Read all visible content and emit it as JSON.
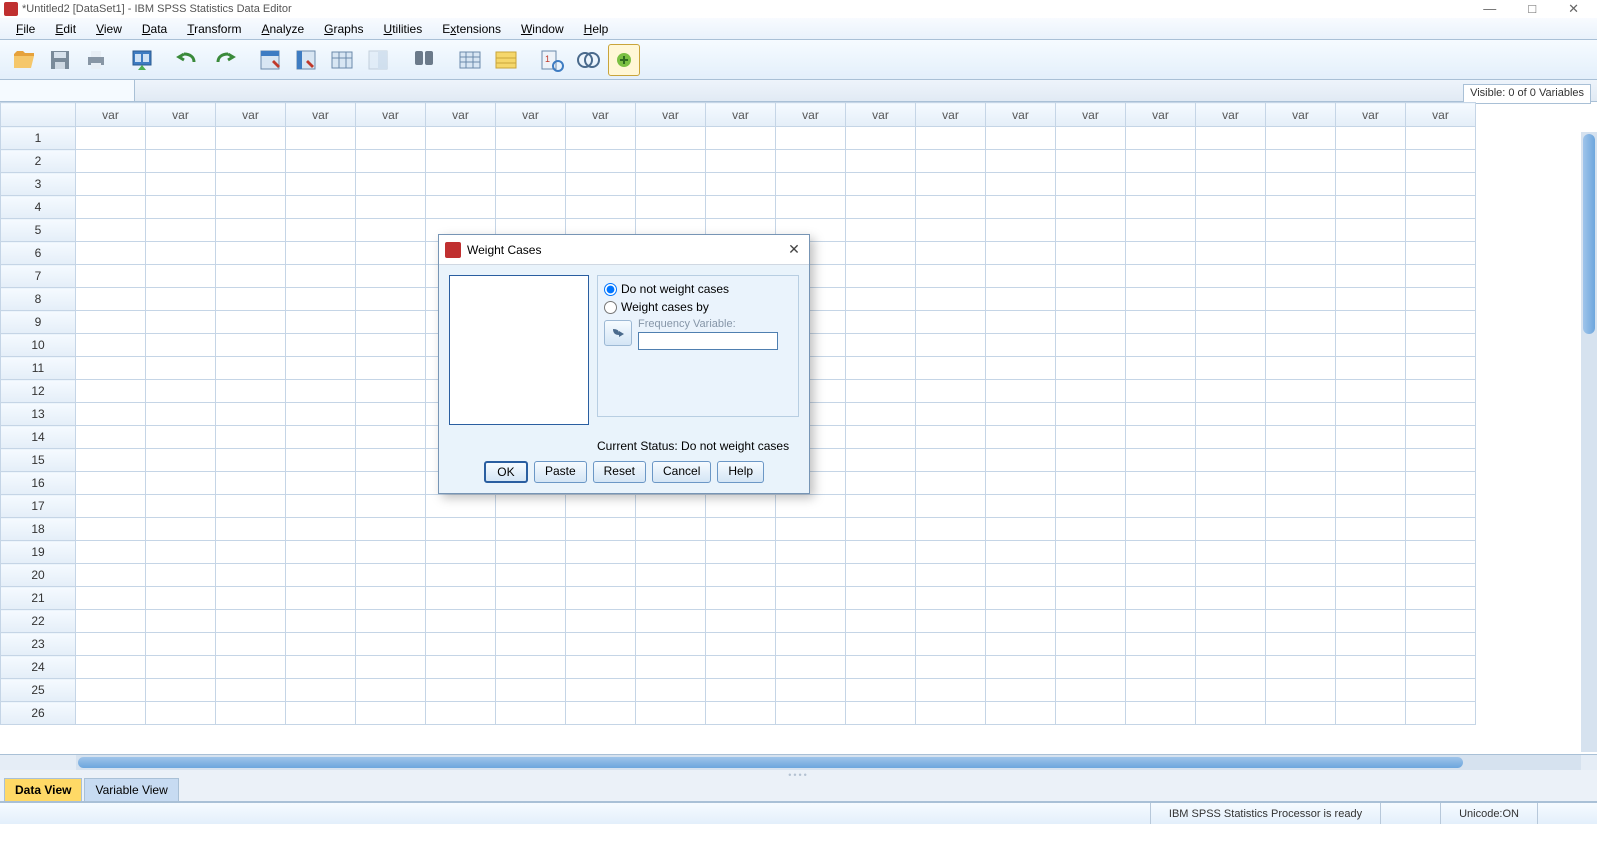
{
  "window": {
    "title": "*Untitled2 [DataSet1] - IBM SPSS Statistics Data Editor",
    "controls": {
      "min": "—",
      "max": "□",
      "close": "✕"
    }
  },
  "menu": {
    "file": "File",
    "edit": "Edit",
    "view": "View",
    "data": "Data",
    "transform": "Transform",
    "analyze": "Analyze",
    "graphs": "Graphs",
    "utilities": "Utilities",
    "extensions": "Extensions",
    "window": "Window",
    "help": "Help"
  },
  "visible_label": "Visible: 0 of 0 Variables",
  "col_header": "var",
  "view_tabs": {
    "data": "Data View",
    "variable": "Variable View"
  },
  "status": {
    "processor": "IBM SPSS Statistics Processor is ready",
    "unicode": "Unicode:ON"
  },
  "dialog": {
    "title": "Weight Cases",
    "opt_none": "Do not weight cases",
    "opt_by": "Weight cases by",
    "freq_label": "Frequency Variable:",
    "status_line": "Current Status: Do not weight cases",
    "buttons": {
      "ok": "OK",
      "paste": "Paste",
      "reset": "Reset",
      "cancel": "Cancel",
      "help": "Help"
    }
  },
  "rows": 26,
  "cols": 20
}
